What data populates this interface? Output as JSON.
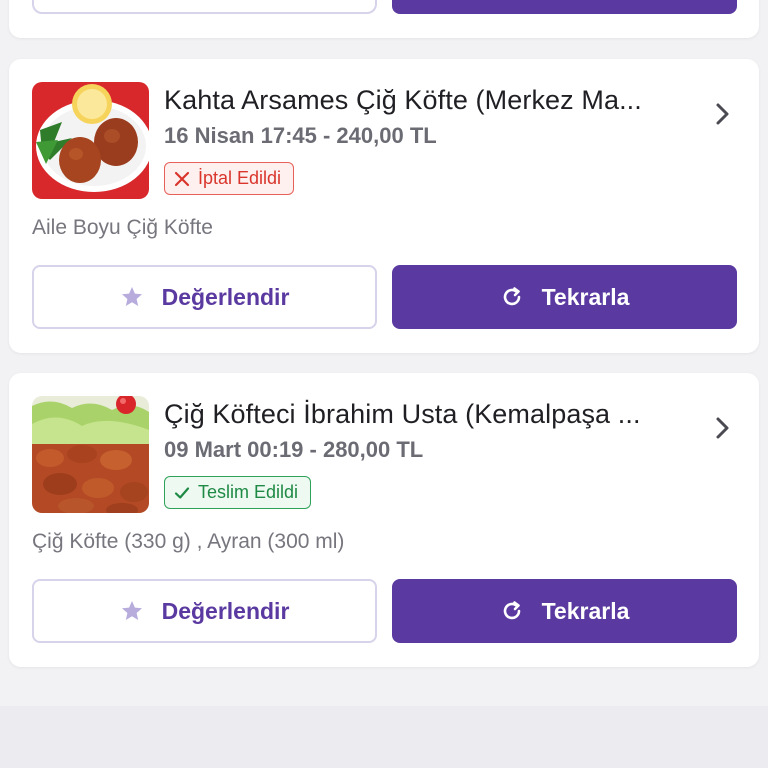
{
  "colors": {
    "accent": "#5a3aa0",
    "cancelled": "#d9352c",
    "delivered": "#1e8a45"
  },
  "orders": [
    {
      "restaurant": "Kahta Arsames Çiğ Köfte (Merkez Ma...",
      "meta": "16 Nisan 17:45 - 240,00 TL",
      "status": "İptal Edildi",
      "status_icon": "close-icon",
      "items": "Aile Boyu Çiğ Köfte",
      "rate_label": "Değerlendir",
      "repeat_label": "Tekrarla"
    },
    {
      "restaurant": "Çiğ Köfteci İbrahim Usta (Kemalpaşa ...",
      "meta": "09 Mart 00:19 - 280,00 TL",
      "status": "Teslim Edildi",
      "status_icon": "check-icon",
      "items": "Çiğ Köfte (330 g) , Ayran (300 ml)",
      "rate_label": "Değerlendir",
      "repeat_label": "Tekrarla"
    }
  ]
}
